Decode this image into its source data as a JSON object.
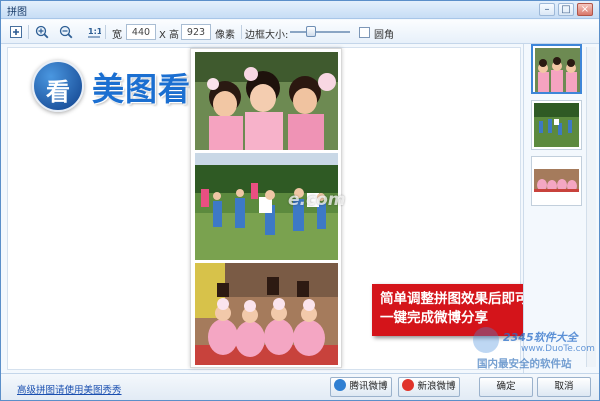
{
  "window": {
    "title": "拼图",
    "controls": [
      "minimize",
      "maximize",
      "close"
    ]
  },
  "toolbar": {
    "width_label": "宽",
    "width_value": "440",
    "height_label": "X 高",
    "height_value": "923",
    "unit_label": "像素",
    "border_label": "边框大小:",
    "rounded_label": "圆角",
    "icons": [
      "add-icon",
      "zoom-in-icon",
      "zoom-out-icon",
      "actual-size-icon"
    ]
  },
  "logo": {
    "badge": "看",
    "text": "美图看看"
  },
  "canvas": {
    "watermark": "e.com"
  },
  "promo": {
    "line1": "简单调整拼图效果后即可",
    "line2": "一键完成微博分享"
  },
  "footer": {
    "link": "高级拼图请使用美图秀秀",
    "tencent_weibo": "腾讯微博",
    "sina_weibo": "新浪微博",
    "ok": "确定",
    "cancel": "取消"
  },
  "site_watermark": {
    "top": "2345软件大全",
    "url": "www.DuoTe.com",
    "bottom": "国内最安全的软件站"
  },
  "colors": {
    "title_bar": "#c7ddf5",
    "promo_bg": "#d4141a",
    "logo_blue": "#1b6fd1",
    "selected_thumb": "#3e86d8"
  }
}
